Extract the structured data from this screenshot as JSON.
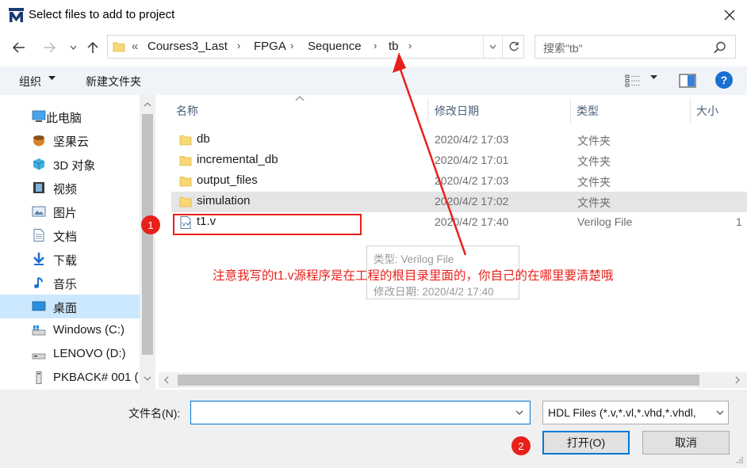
{
  "window": {
    "title": "Select files to add to project",
    "logo_letter": "M"
  },
  "nav": {
    "breadcrumbs": [
      "Courses3_Last",
      "FPGA",
      "Sequence",
      "tb"
    ],
    "overflow": "«"
  },
  "search": {
    "placeholder": "搜索\"tb\""
  },
  "toolbar": {
    "organize_label": "组织",
    "new_folder_label": "新建文件夹",
    "help_label": "?"
  },
  "sidebar": {
    "items": [
      {
        "label": "此电脑",
        "icon": "computer-icon"
      },
      {
        "label": "坚果云",
        "icon": "nutstore-icon"
      },
      {
        "label": "3D 对象",
        "icon": "3d-objects-icon"
      },
      {
        "label": "视频",
        "icon": "video-icon"
      },
      {
        "label": "图片",
        "icon": "pictures-icon"
      },
      {
        "label": "文档",
        "icon": "documents-icon"
      },
      {
        "label": "下载",
        "icon": "download-icon"
      },
      {
        "label": "音乐",
        "icon": "music-icon"
      },
      {
        "label": "桌面",
        "icon": "desktop-icon",
        "selected": true
      },
      {
        "label": "Windows (C:)",
        "icon": "drive-icon"
      },
      {
        "label": "LENOVO (D:)",
        "icon": "drive-icon"
      },
      {
        "label": "PKBACK# 001 (",
        "icon": "usb-drive-icon"
      }
    ]
  },
  "filelist": {
    "columns": [
      "名称",
      "修改日期",
      "类型",
      "大小"
    ],
    "rows": [
      {
        "name": "db",
        "date": "2020/4/2 17:03",
        "type": "文件夹",
        "size": "",
        "kind": "folder"
      },
      {
        "name": "incremental_db",
        "date": "2020/4/2 17:01",
        "type": "文件夹",
        "size": "",
        "kind": "folder"
      },
      {
        "name": "output_files",
        "date": "2020/4/2 17:03",
        "type": "文件夹",
        "size": "",
        "kind": "folder"
      },
      {
        "name": "simulation",
        "date": "2020/4/2 17:02",
        "type": "文件夹",
        "size": "",
        "kind": "folder",
        "hover": true
      },
      {
        "name": "t1.v",
        "date": "2020/4/2 17:40",
        "type": "Verilog File",
        "size": "1",
        "kind": "verilog"
      }
    ]
  },
  "tooltip": {
    "line1": "类型: Verilog File",
    "line2": "修改日期: 2020/4/2 17:40"
  },
  "annotation": {
    "note": "注意我写的t1.v源程序是在工程的根目录里面的，你自己的在哪里要清楚哦",
    "badge1": "1",
    "badge2": "2",
    "color": "#e8201a"
  },
  "bottom": {
    "filename_label": "文件名(N):",
    "filename_value": "",
    "filter_value": "HDL Files (*.v,*.vl,*.vhd,*.vhdl,",
    "open_label": "打开(O)",
    "cancel_label": "取消"
  }
}
